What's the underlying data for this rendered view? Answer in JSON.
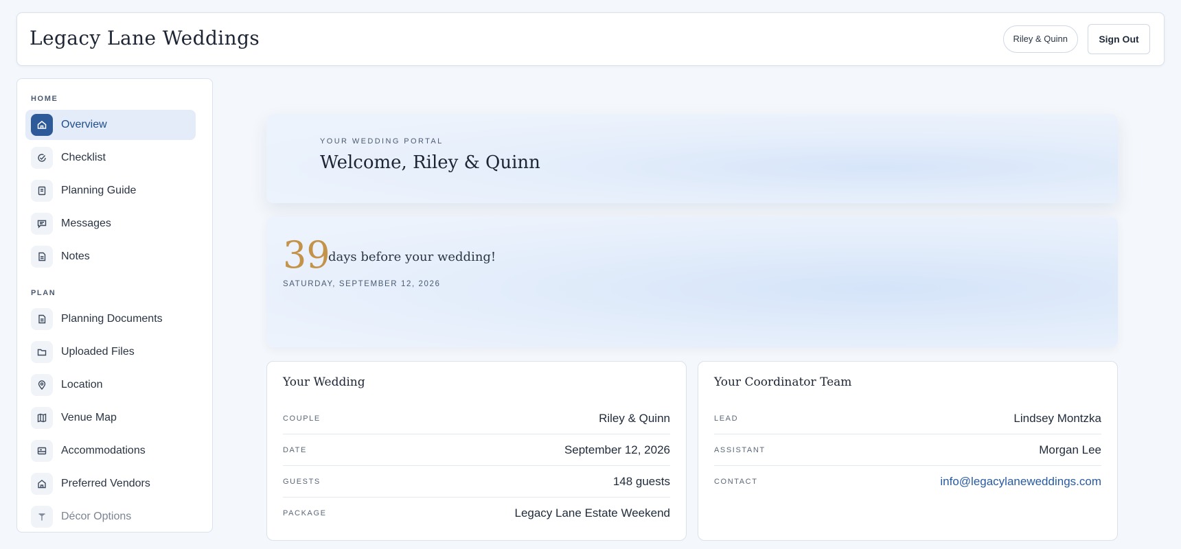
{
  "header": {
    "brand": "Legacy Lane Weddings",
    "user_pill": "Riley & Quinn",
    "signout_label": "Sign Out"
  },
  "sidebar": {
    "sections": [
      {
        "label": "HOME",
        "items": [
          {
            "label": "Overview",
            "icon": "home-icon",
            "active": true
          },
          {
            "label": "Checklist",
            "icon": "check-circle-icon"
          },
          {
            "label": "Planning Guide",
            "icon": "book-icon"
          },
          {
            "label": "Messages",
            "icon": "message-icon"
          },
          {
            "label": "Notes",
            "icon": "note-icon"
          }
        ]
      },
      {
        "label": "PLAN",
        "items": [
          {
            "label": "Planning Documents",
            "icon": "document-icon"
          },
          {
            "label": "Uploaded Files",
            "icon": "folder-icon"
          },
          {
            "label": "Location",
            "icon": "location-pin-icon"
          },
          {
            "label": "Venue Map",
            "icon": "map-icon"
          },
          {
            "label": "Accommodations",
            "icon": "bed-icon"
          },
          {
            "label": "Preferred Vendors",
            "icon": "store-icon"
          },
          {
            "label": "Décor Options",
            "icon": "decor-icon"
          }
        ]
      }
    ]
  },
  "welcome": {
    "kicker": "YOUR WEDDING PORTAL",
    "title": "Welcome, Riley & Quinn"
  },
  "countdown": {
    "days": "39",
    "text": "days before your wedding!",
    "date": "SATURDAY, SEPTEMBER 12, 2026"
  },
  "wedding_card": {
    "title": "Your Wedding",
    "rows": [
      {
        "label": "COUPLE",
        "value": "Riley & Quinn"
      },
      {
        "label": "DATE",
        "value": "September 12, 2026"
      },
      {
        "label": "GUESTS",
        "value": "148 guests"
      },
      {
        "label": "PACKAGE",
        "value": "Legacy Lane Estate Weekend"
      }
    ]
  },
  "coordinator_card": {
    "title": "Your Coordinator Team",
    "rows": [
      {
        "label": "LEAD",
        "value": "Lindsey Montzka"
      },
      {
        "label": "ASSISTANT",
        "value": "Morgan Lee"
      },
      {
        "label": "CONTACT",
        "value": "info@legacylaneweddings.com"
      }
    ]
  },
  "colors": {
    "accent": "#2d5b99",
    "gold": "#c3934a",
    "link": "#275aa3"
  }
}
